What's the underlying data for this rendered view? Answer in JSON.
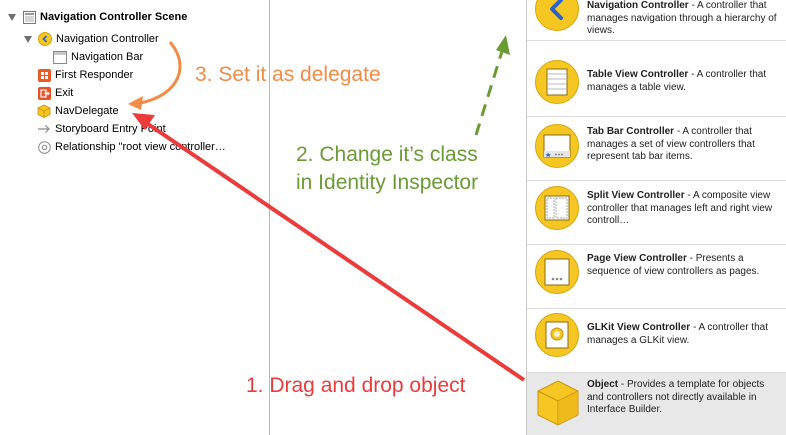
{
  "outline": {
    "scene_title": "Navigation Controller Scene",
    "items": [
      {
        "label": "Navigation Controller"
      },
      {
        "label": "Navigation Bar"
      },
      {
        "label": "First Responder"
      },
      {
        "label": "Exit"
      },
      {
        "label": "NavDelegate"
      },
      {
        "label": "Storyboard Entry Point"
      },
      {
        "label": "Relationship \"root view controller…"
      }
    ]
  },
  "library": {
    "items": [
      {
        "title": "Navigation Controller",
        "desc": " - A controller that manages navigation through a hierarchy of views.",
        "icon": "navigation-controller-icon"
      },
      {
        "title": "Table View Controller",
        "desc": " - A controller that manages a table view.",
        "icon": "table-view-controller-icon"
      },
      {
        "title": "Tab Bar Controller",
        "desc": " - A controller that manages a set of view controllers that represent tab bar items.",
        "icon": "tab-bar-controller-icon"
      },
      {
        "title": "Split View Controller",
        "desc": " - A composite view controller that manages left and right view controll…",
        "icon": "split-view-controller-icon"
      },
      {
        "title": "Page View Controller",
        "desc": " - Presents a sequence of view controllers as pages.",
        "icon": "page-view-controller-icon"
      },
      {
        "title": "GLKit View Controller",
        "desc": " - A controller that manages a GLKit view.",
        "icon": "glkit-view-controller-icon"
      },
      {
        "title": "Object",
        "desc": " - Provides a template for objects and controllers not directly available in Interface Builder.",
        "icon": "object-icon"
      }
    ]
  },
  "annotations": {
    "step3": "3. Set it as delegate",
    "step2_line1": "2. Change it’s class",
    "step2_line2": "in Identity Inspector",
    "step1": "1. Drag and drop object"
  },
  "colors": {
    "orange": "#f28b45",
    "green": "#6b9b35",
    "red": "#ec3b3b",
    "icon_yellow": "#f6c623"
  }
}
